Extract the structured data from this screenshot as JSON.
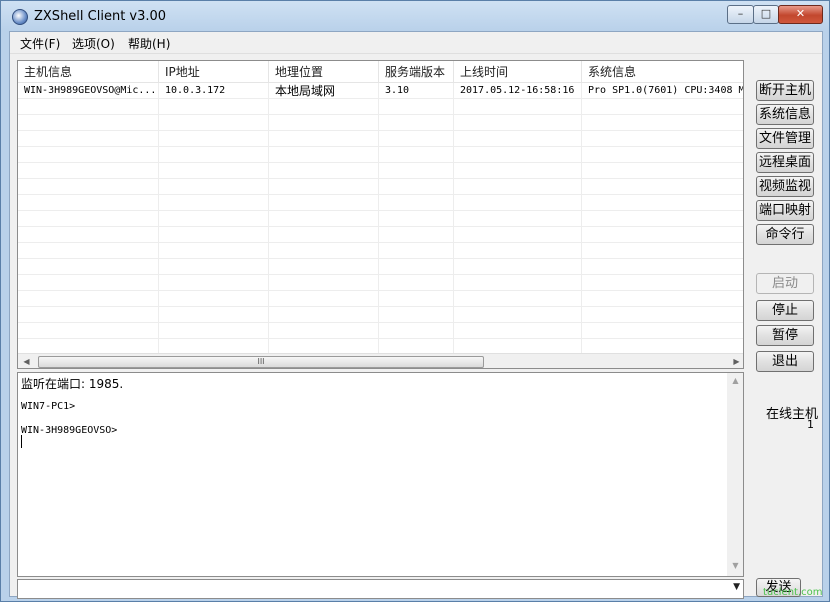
{
  "window": {
    "title": "ZXShell Client v3.00",
    "controls": {
      "minimize": "–",
      "maximize": "□",
      "close": "✕"
    }
  },
  "menu": [
    "文件(F)",
    "选项(O)",
    "帮助(H)"
  ],
  "table": {
    "columns": [
      "主机信息",
      "IP地址",
      "地理位置",
      "服务端版本",
      "上线时间",
      "系统信息"
    ],
    "rows": [
      [
        "WIN-3H989GEOVSO@Mic...",
        "10.0.3.172",
        "本地局域网",
        "3.10",
        "2017.05.12-16:58:16",
        "Pro SP1.0(7601) CPU:3408 M"
      ]
    ],
    "hscroll_thumb": "III"
  },
  "console": {
    "lines": [
      "监听在端口: 1985.",
      "WIN7-PC1>",
      "WIN-3H989GEOVSO>"
    ]
  },
  "buttons": {
    "disconnect": "断开主机",
    "sysinfo": "系统信息",
    "filemgr": "文件管理",
    "remote_desktop": "远程桌面",
    "video": "视频监视",
    "port_map": "端口映射",
    "cmd": "命令行",
    "start": "启动",
    "stop": "停止",
    "pause": "暂停",
    "exit": "退出",
    "send": "发送"
  },
  "status": {
    "online_label": "在线主机",
    "online_count": "1"
  },
  "watermark": "tuclent.com"
}
